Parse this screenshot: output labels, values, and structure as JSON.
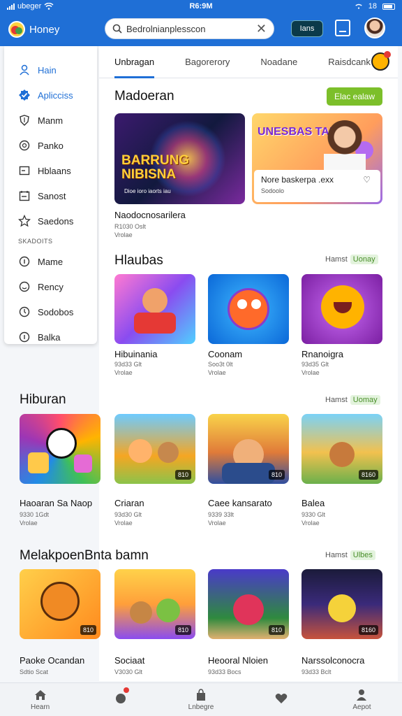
{
  "status_bar": {
    "carrier": "ubeger",
    "time": "R6:9M",
    "battery": "18"
  },
  "app": {
    "title": "Honey",
    "search_value": "Bedrolnianplesscon",
    "pill_label": "Ians"
  },
  "sidebar": {
    "items": [
      {
        "label": "Hain",
        "icon": "person-icon",
        "active": false
      },
      {
        "label": "Aplicciss",
        "icon": "badge-check-icon",
        "active": true
      },
      {
        "label": "Manm",
        "icon": "shield-icon",
        "active": false
      },
      {
        "label": "Panko",
        "icon": "gear-circle-icon",
        "active": false
      },
      {
        "label": "Hblaans",
        "icon": "window-icon",
        "active": false
      },
      {
        "label": "Sanost",
        "icon": "calendar-icon",
        "active": false
      },
      {
        "label": "Saedons",
        "icon": "star-icon",
        "active": false
      }
    ],
    "section_label": "SKADOITS",
    "section_items": [
      {
        "label": "Mame",
        "icon": "info-icon"
      },
      {
        "label": "Rency",
        "icon": "smile-icon"
      },
      {
        "label": "Sodobos",
        "icon": "clock-icon"
      },
      {
        "label": "Balka",
        "icon": "info-circle-icon"
      }
    ]
  },
  "tabs": [
    "Unbragan",
    "Bagorerory",
    "Noadane",
    "Raisdcank"
  ],
  "featured": {
    "title": "Madoeran",
    "button": "Elac ealaw",
    "banner1": {
      "title": "BARRUNG NIBISNA",
      "subtitle": "Dioe ioro iaorts iau",
      "name": "Naodocnosarilera",
      "meta1": "R1030 Oslt",
      "meta2": "Vrolae"
    },
    "banner2": {
      "title": "UNESBAS TAMIN",
      "card_title": "Nore baskerpa .exx",
      "card_sub": "Sodoolo"
    }
  },
  "section1": {
    "title": "Hlaubas",
    "more_label": "Hamst",
    "more_tag": "Uonay",
    "games": [
      {
        "name": "Hibuinania",
        "meta1": "93d33 Glt",
        "meta2": "Vrolae"
      },
      {
        "name": "Coonam",
        "meta1": "Soo3t 0lt",
        "meta2": "Vrolae"
      },
      {
        "name": "Rnanoigra",
        "meta1": "93d35 Glt",
        "meta2": "Vrolae"
      }
    ]
  },
  "section2": {
    "title": "Hiburan",
    "more_label": "Hamst",
    "more_tag": "Uomay",
    "games": [
      {
        "name": "Haoaran Sa Naop",
        "meta1": "9330 1Gdt",
        "meta2": "Vrolae",
        "badge": ""
      },
      {
        "name": "Criaran",
        "meta1": "93d30 Glt",
        "meta2": "Vrolae",
        "badge": "810"
      },
      {
        "name": "Caee kansarato",
        "meta1": "9339 33lt",
        "meta2": "Vrolae",
        "badge": "810"
      },
      {
        "name": "Balea",
        "meta1": "9330 Glt",
        "meta2": "Vrolae",
        "badge": "8160"
      }
    ]
  },
  "section3": {
    "title": "MelakpoenBnta bamn",
    "more_label": "Hamst",
    "more_tag": "Ulbes",
    "games": [
      {
        "name": "Paoke Ocandan",
        "meta1": "Sdtio Scat",
        "badge": "810"
      },
      {
        "name": "Sociaat",
        "meta1": "V3030 Glt",
        "badge": "810"
      },
      {
        "name": "Heooral Nloien",
        "meta1": "93d33 Bocs",
        "badge": "810"
      },
      {
        "name": "Narssolconocra",
        "meta1": "93d33 Bclt",
        "badge": "8160"
      }
    ]
  },
  "bottom_nav": [
    {
      "label": "Hearn",
      "icon": "home-icon"
    },
    {
      "label": "",
      "icon": "notification-icon"
    },
    {
      "label": "Lnbegre",
      "icon": "bag-icon"
    },
    {
      "label": "",
      "icon": "heart-icon"
    },
    {
      "label": "Aepot",
      "icon": "profile-icon"
    }
  ]
}
